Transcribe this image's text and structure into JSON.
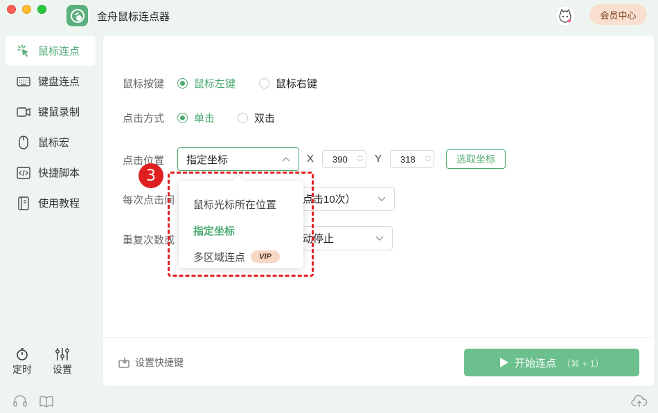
{
  "window": {
    "title": "金舟鼠标连点器"
  },
  "header": {
    "vip_center": "会员中心"
  },
  "sidebar": {
    "items": [
      {
        "label": "鼠标连点",
        "icon": "cursor-click-icon",
        "active": true
      },
      {
        "label": "键盘连点",
        "icon": "keyboard-icon",
        "active": false
      },
      {
        "label": "键鼠录制",
        "icon": "record-icon",
        "active": false
      },
      {
        "label": "鼠标宏",
        "icon": "mouse-icon",
        "active": false
      },
      {
        "label": "快捷脚本",
        "icon": "code-icon",
        "active": false
      },
      {
        "label": "使用教程",
        "icon": "book-icon",
        "active": false
      }
    ],
    "timer_label": "定时",
    "settings_label": "设置"
  },
  "form": {
    "button_label": "鼠标按键",
    "button_left": "鼠标左键",
    "button_right": "鼠标右键",
    "click_mode_label": "点击方式",
    "single_click": "单击",
    "double_click": "双击",
    "position_label": "点击位置",
    "position_value": "指定坐标",
    "x_label": "X",
    "x_value": "390",
    "y_label": "Y",
    "y_value": "318",
    "pick_button": "选取坐标",
    "interval_label": "每次点击间",
    "interval_value": "点击10次）",
    "repeat_label": "重复次数或",
    "repeat_value": "动停止"
  },
  "dropdown": {
    "options": [
      {
        "label": "鼠标光标所在位置",
        "selected": false
      },
      {
        "label": "指定坐标",
        "selected": true
      },
      {
        "label": "多区域连点",
        "selected": false,
        "badge": "VIP"
      }
    ]
  },
  "annotation": {
    "step_number": "3"
  },
  "footer": {
    "shortcut_label": "设置快捷键",
    "start_button": "开始连点",
    "start_hint": "（⌘ + 1）"
  },
  "colors": {
    "accent": "#4caa72",
    "start_button": "#6cc08e",
    "annotation": "#e02020"
  }
}
